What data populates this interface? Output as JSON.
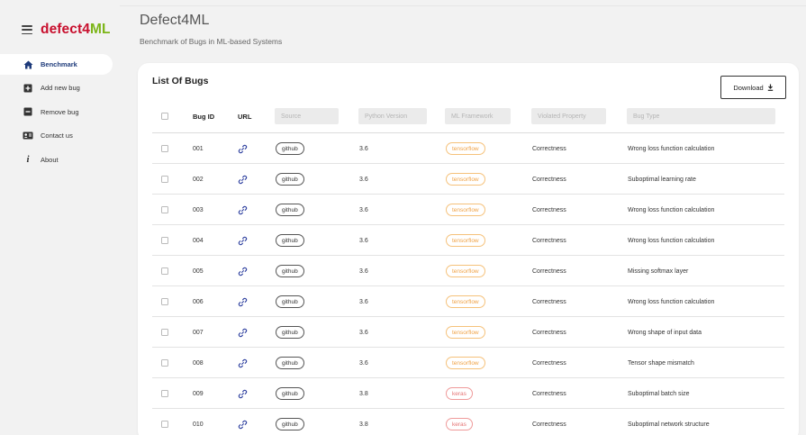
{
  "brand": {
    "part1": "defect4",
    "part2": "ML"
  },
  "header": {
    "title": "Defect4ML",
    "subtitle": "Benchmark of Bugs in ML-based Systems"
  },
  "sidebar": {
    "items": [
      {
        "label": "Benchmark",
        "icon": "home-icon",
        "active": true
      },
      {
        "label": "Add new bug",
        "icon": "add-box-icon",
        "active": false
      },
      {
        "label": "Remove bug",
        "icon": "remove-box-icon",
        "active": false
      },
      {
        "label": "Contact us",
        "icon": "contact-card-icon",
        "active": false
      },
      {
        "label": "About",
        "icon": "info-icon",
        "active": false
      }
    ]
  },
  "card": {
    "title": "List Of Bugs",
    "download_label": "Download"
  },
  "table": {
    "columns": {
      "bug_id": "Bug ID",
      "url": "URL",
      "source": "Source",
      "python_version": "Python Version",
      "ml_framework": "ML Framework",
      "violated_property": "Violated Property",
      "bug_type": "Bug Type"
    },
    "rows": [
      {
        "id": "001",
        "source": "github",
        "python": "3.6",
        "framework": "tensorflow",
        "property": "Correctness",
        "type": "Wrong loss function calculation"
      },
      {
        "id": "002",
        "source": "github",
        "python": "3.6",
        "framework": "tensorflow",
        "property": "Correctness",
        "type": "Suboptimal learning rate"
      },
      {
        "id": "003",
        "source": "github",
        "python": "3.6",
        "framework": "tensorflow",
        "property": "Correctness",
        "type": "Wrong loss function calculation"
      },
      {
        "id": "004",
        "source": "github",
        "python": "3.6",
        "framework": "tensorflow",
        "property": "Correctness",
        "type": "Wrong loss function calculation"
      },
      {
        "id": "005",
        "source": "github",
        "python": "3.6",
        "framework": "tensorflow",
        "property": "Correctness",
        "type": "Missing softmax layer"
      },
      {
        "id": "006",
        "source": "github",
        "python": "3.6",
        "framework": "tensorflow",
        "property": "Correctness",
        "type": "Wrong loss function calculation"
      },
      {
        "id": "007",
        "source": "github",
        "python": "3.6",
        "framework": "tensorflow",
        "property": "Correctness",
        "type": "Wrong shape of input data"
      },
      {
        "id": "008",
        "source": "github",
        "python": "3.6",
        "framework": "tensorflow",
        "property": "Correctness",
        "type": "Tensor shape mismatch"
      },
      {
        "id": "009",
        "source": "github",
        "python": "3.8",
        "framework": "keras",
        "property": "Correctness",
        "type": "Suboptimal batch size"
      },
      {
        "id": "010",
        "source": "github",
        "python": "3.8",
        "framework": "keras",
        "property": "Correctness",
        "type": "Suboptimal network structure"
      }
    ]
  },
  "colors": {
    "brand_red": "#c8102e",
    "brand_green": "#7cb518",
    "active_nav": "#1d3a7a",
    "link_icon": "#2c3e9e",
    "tensorflow_pill": "#f0a347",
    "keras_pill": "#e57373"
  }
}
